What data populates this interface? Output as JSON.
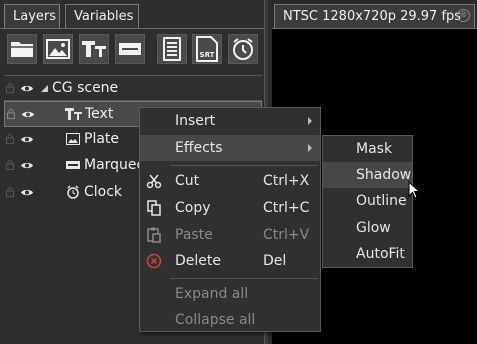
{
  "tabs": {
    "layers": "Layers",
    "variables": "Variables"
  },
  "toolbar": {
    "buttons": [
      {
        "icon": "folder-icon"
      },
      {
        "icon": "image-icon"
      },
      {
        "icon": "text-tool-icon",
        "label": "TT"
      },
      {
        "icon": "marquee-icon"
      },
      {
        "icon": "document-icon"
      },
      {
        "icon": "subtitle-icon",
        "label": "SRT"
      },
      {
        "icon": "clock-icon"
      }
    ]
  },
  "layers": {
    "scene": {
      "label": "CG scene"
    },
    "items": [
      {
        "label": "Text",
        "icon": "text-layer-icon",
        "icon_text": "TT",
        "selected": true
      },
      {
        "label": "Plate",
        "icon": "image-icon"
      },
      {
        "label": "Marquee",
        "icon": "marquee-icon"
      },
      {
        "label": "Clock",
        "icon": "clock-icon"
      }
    ]
  },
  "preview": {
    "title": "NTSC 1280x720p 29.97 fps",
    "close": "⊗"
  },
  "context_menu": {
    "items": [
      {
        "label": "Insert",
        "submenu": true
      },
      {
        "label": "Effects",
        "submenu": true,
        "highlighted": true
      },
      {
        "label": "Cut",
        "shortcut": "Ctrl+X",
        "icon": "scissors-icon"
      },
      {
        "label": "Copy",
        "shortcut": "Ctrl+C",
        "icon": "copy-icon"
      },
      {
        "label": "Paste",
        "shortcut": "Ctrl+V",
        "icon": "paste-icon",
        "disabled": true
      },
      {
        "label": "Delete",
        "shortcut": "Del",
        "icon": "delete-icon"
      },
      {
        "label": "Expand all",
        "disabled": true
      },
      {
        "label": "Collapse all",
        "disabled": true
      }
    ]
  },
  "effects_submenu": {
    "items": [
      {
        "label": "Mask"
      },
      {
        "label": "Shadow",
        "highlighted": true
      },
      {
        "label": "Outline"
      },
      {
        "label": "Glow"
      },
      {
        "label": "AutoFit"
      }
    ]
  },
  "colors": {
    "panel_bg": "#2d2d2d",
    "menu_bg": "#303030",
    "menu_highlight": "#474747",
    "delete_red": "#e03c3c",
    "preview_bg": "#000000"
  }
}
